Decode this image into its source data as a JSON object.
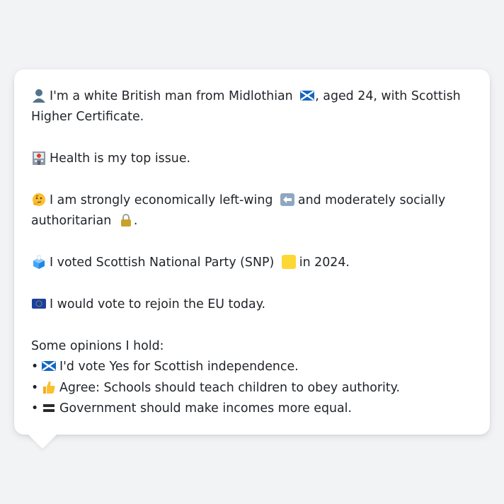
{
  "message": {
    "intro_text": "I'm a white British man from Midlothian",
    "intro_tail": ", aged 24, with Scottish Higher Certificate.",
    "health_text": "Health is my top issue.",
    "econ_text_1": "I am strongly economically left-wing",
    "econ_text_2": "and moderately socially authoritarian",
    "econ_tail": ".",
    "vote_text_1": "I voted Scottish National Party (SNP)",
    "vote_text_2": "in 2024.",
    "eu_text": "I would vote to rejoin the EU today.",
    "opinions_heading": "Some opinions I hold:",
    "opinions": [
      {
        "bullet": "•",
        "icon": "scotland-flag-icon",
        "text": "I'd vote Yes for Scottish independence."
      },
      {
        "bullet": "•",
        "icon": "thumbs-up-icon",
        "text": "Agree: Schools should teach children to obey authority."
      },
      {
        "bullet": "•",
        "icon": "equals-icon",
        "text": "Government should make incomes more equal."
      }
    ]
  },
  "colors": {
    "background": "#f2f3f5",
    "bubble": "#ffffff",
    "text": "#1f2328",
    "snp_yellow": "#fdd835",
    "saltire_blue": "#1565c0",
    "eu_blue": "#1b3fa0"
  }
}
